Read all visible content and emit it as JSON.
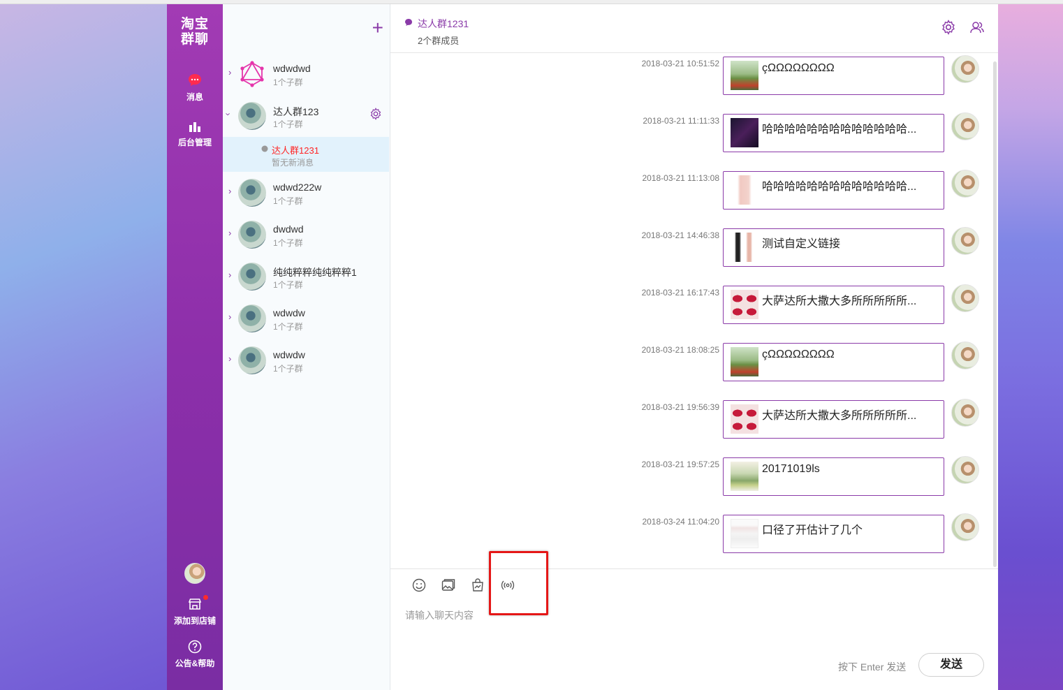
{
  "nav": {
    "logo_line1": "淘宝",
    "logo_line2": "群聊",
    "messages_label": "消息",
    "admin_label": "后台管理",
    "add_store_label": "添加到店铺",
    "help_label": "公告&帮助",
    "accent_color": "#9b35b0"
  },
  "groups": [
    {
      "name": "wdwdwd",
      "sub": "1个子群"
    },
    {
      "name": "达人群123",
      "sub": "1个子群"
    },
    {
      "name": "wdwd222w",
      "sub": "1个子群"
    },
    {
      "name": "dwdwd",
      "sub": "1个子群"
    },
    {
      "name": "纯纯粹粹纯纯粹粹1",
      "sub": "1个子群"
    },
    {
      "name": "wdwdw",
      "sub": "1个子群"
    },
    {
      "name": "wdwdw",
      "sub": "1个子群"
    }
  ],
  "subgroup": {
    "name": "达人群1231",
    "status": "暂无新消息"
  },
  "chat": {
    "title": "达人群1231",
    "members": "2个群成员"
  },
  "messages": [
    {
      "time": "2018-03-21 10:51:52",
      "text": "çΩΩΩΩΩΩΩΩ"
    },
    {
      "time": "2018-03-21 11:11:33",
      "text": "哈哈哈哈哈哈哈哈哈哈哈哈哈..."
    },
    {
      "time": "2018-03-21 11:13:08",
      "text": "哈哈哈哈哈哈哈哈哈哈哈哈哈..."
    },
    {
      "time": "2018-03-21 14:46:38",
      "text": "测试自定义链接"
    },
    {
      "time": "2018-03-21 16:17:43",
      "text": "大萨达所大撒大多所所所所所..."
    },
    {
      "time": "2018-03-21 18:08:25",
      "text": "çΩΩΩΩΩΩΩΩ"
    },
    {
      "time": "2018-03-21 19:56:39",
      "text": "大萨达所大撒大多所所所所所..."
    },
    {
      "time": "2018-03-21 19:57:25",
      "text": "20171019ls"
    },
    {
      "time": "2018-03-24 11:04:20",
      "text": "口径了开估计了几个"
    }
  ],
  "composer": {
    "placeholder": "请输入聊天内容",
    "hint": "按下 Enter 发送",
    "send_label": "发送"
  }
}
